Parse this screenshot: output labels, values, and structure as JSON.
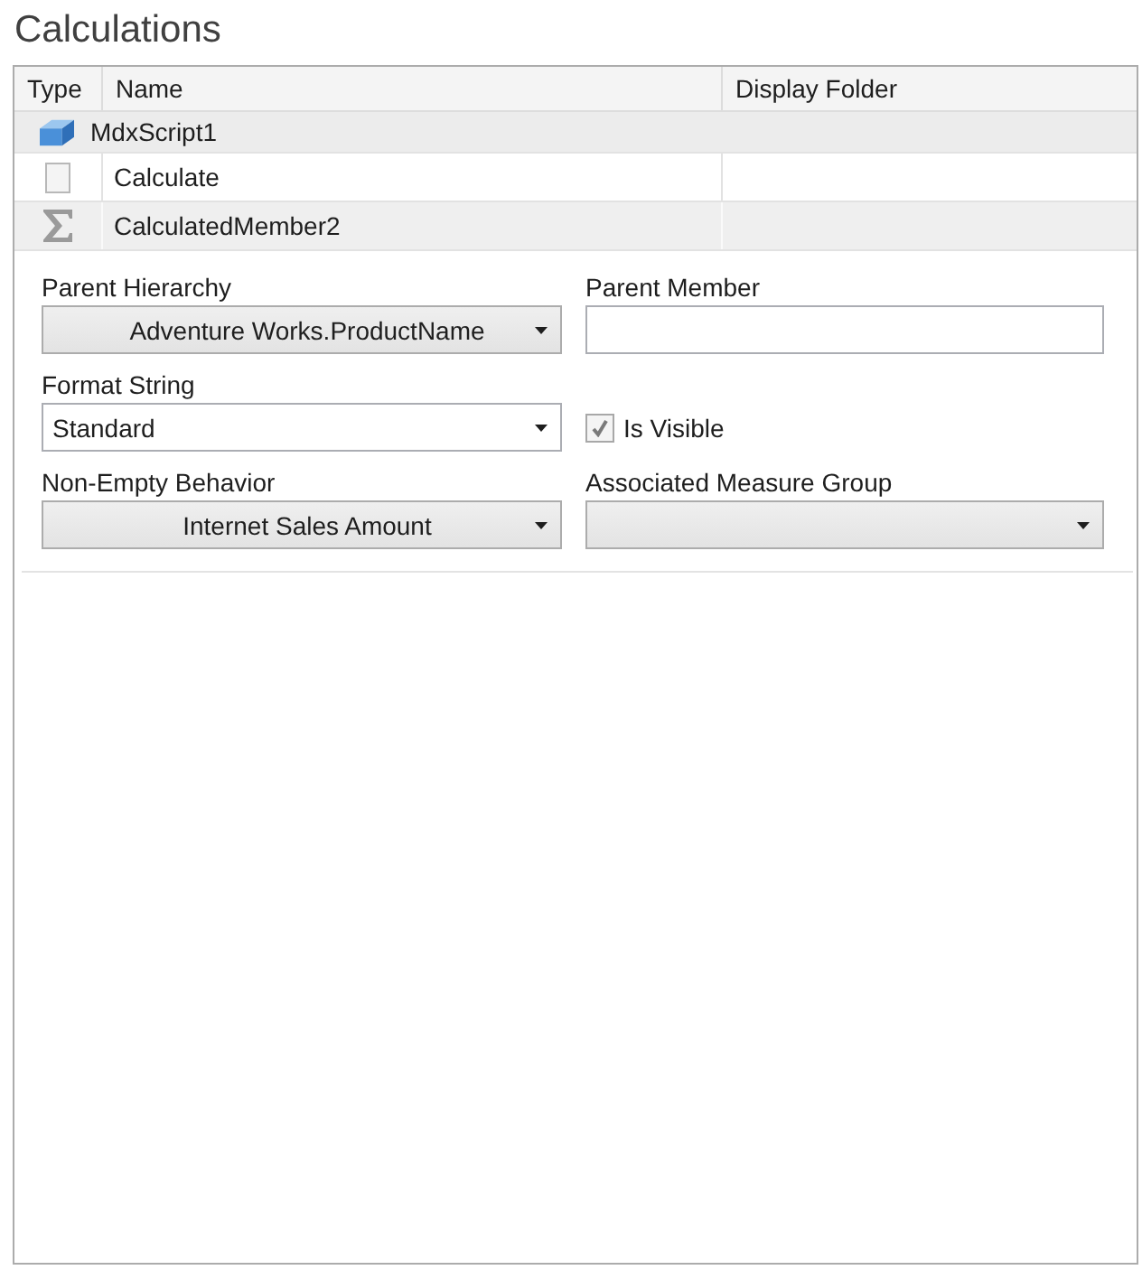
{
  "title": "Calculations",
  "table": {
    "columns": [
      "Type",
      "Name",
      "Display Folder"
    ],
    "rows": [
      {
        "kind": "script",
        "name": "MdxScript1",
        "selected": false
      },
      {
        "kind": "command",
        "name": "Calculate",
        "selected": false
      },
      {
        "kind": "calculated_member",
        "name": "CalculatedMember2",
        "selected": true
      }
    ]
  },
  "form": {
    "fields": [
      {
        "kind": "dropdown",
        "label": "Parent Hierarchy",
        "value": "Adventure Works.ProductName"
      },
      {
        "kind": "textbox",
        "label": "Parent Member"
      },
      {
        "kind": "editable_dropdown",
        "label": "Format String",
        "value": "Standard"
      },
      {
        "kind": "checkbox",
        "label": "Is Visible",
        "checked": true
      },
      {
        "kind": "dropdown",
        "label": "Non-Empty Behavior",
        "value": "Internet Sales Amount"
      },
      {
        "kind": "dropdown",
        "label": "Associated Measure Group"
      }
    ]
  }
}
